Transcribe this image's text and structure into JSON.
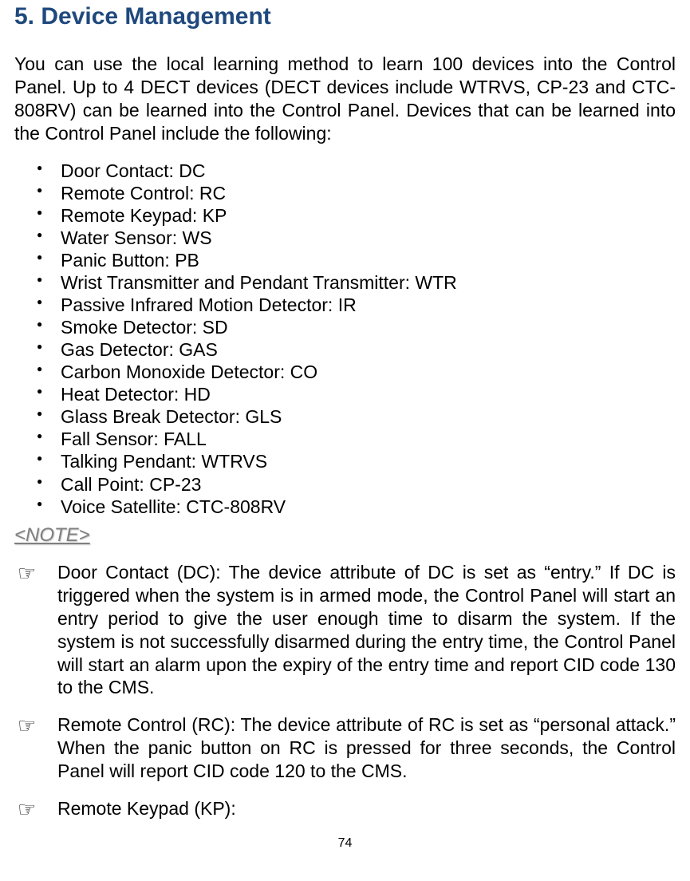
{
  "heading": "5. Device Management",
  "intro": "You can use the local learning method to learn 100 devices into the Control Panel. Up to 4 DECT devices (DECT devices include WTRVS, CP-23 and CTC-808RV) can be learned into the Control Panel. Devices that can be learned into the Control Panel include the following:",
  "devices": [
    "Door Contact: DC",
    "Remote Control: RC",
    "Remote Keypad: KP",
    "Water Sensor: WS",
    "Panic Button: PB",
    "Wrist Transmitter and Pendant Transmitter: WTR",
    "Passive Infrared Motion Detector: IR",
    "Smoke Detector: SD",
    "Gas Detector: GAS",
    "Carbon Monoxide Detector: CO",
    "Heat Detector: HD",
    "Glass Break Detector: GLS",
    "Fall Sensor: FALL",
    "Talking Pendant: WTRVS",
    "Call Point: CP-23",
    "Voice Satellite: CTC-808RV"
  ],
  "noteLabel": "<NOTE>",
  "notes": [
    "Door Contact (DC): The device attribute of DC is set as “entry.” If DC is triggered when the system is in armed mode, the Control Panel will start an entry period to give the user enough time to disarm the system. If the system is not successfully disarmed during the entry time, the Control Panel will start an alarm upon the expiry of the entry time and report CID code 130 to the CMS.",
    "Remote Control (RC): The device attribute of RC is set as “personal attack.” When the panic button on RC is pressed for three seconds, the Control Panel will report CID code 120 to the CMS.",
    "Remote Keypad (KP):"
  ],
  "pageNumber": "74"
}
